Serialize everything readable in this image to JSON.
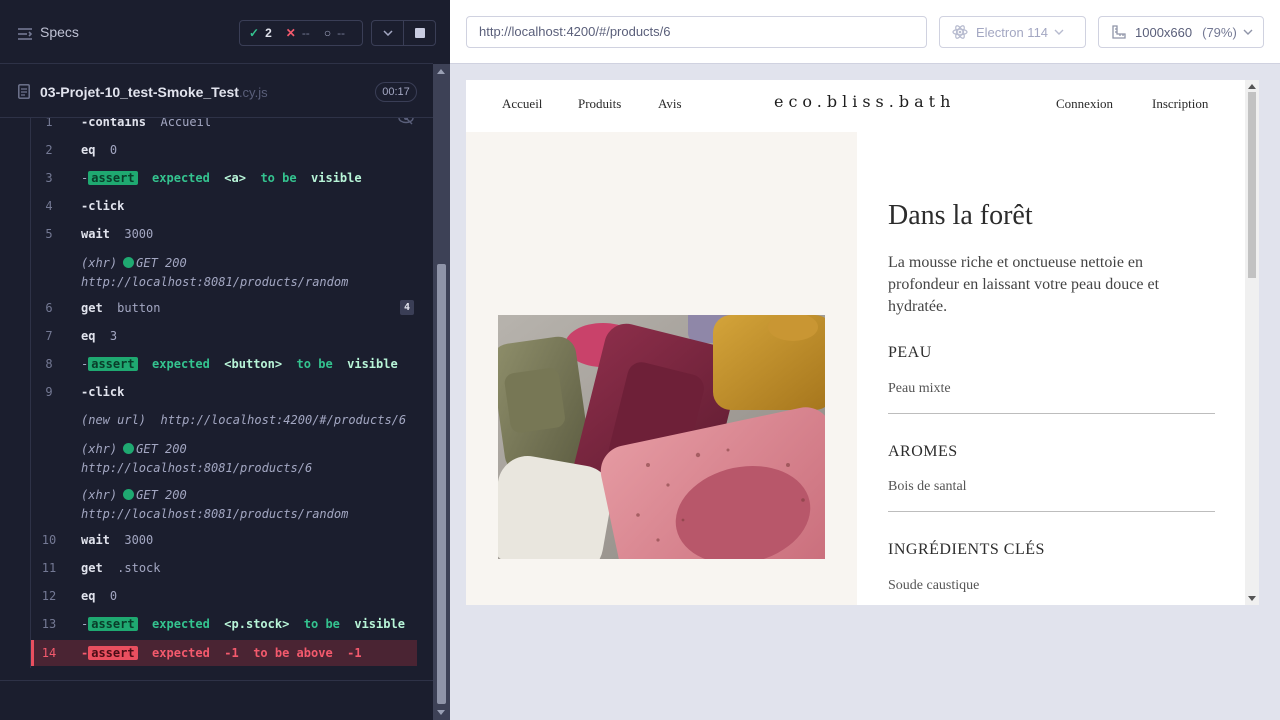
{
  "runner": {
    "specs_label": "Specs",
    "stats": {
      "passed": "2",
      "failed": "--",
      "pending": "--"
    },
    "file": {
      "name": "03-Projet-10_test-Smoke_Test",
      "ext": ".cy.js",
      "duration": "00:17"
    }
  },
  "commands": [
    {
      "num": "1",
      "parts": [
        "-contains",
        "Accueil"
      ]
    },
    {
      "num": "2",
      "parts": [
        "eq",
        "0"
      ]
    },
    {
      "num": "3",
      "parts": [
        "-",
        "assert",
        "expected",
        "<a>",
        "to be",
        "visible"
      ]
    },
    {
      "num": "4",
      "parts": [
        "-click"
      ]
    },
    {
      "num": "5",
      "parts": [
        "wait",
        "3000"
      ]
    },
    {
      "num": "",
      "parts": [
        "(xhr)",
        "GET 200",
        "http://localhost:8081/products/random"
      ]
    },
    {
      "num": "6",
      "parts": [
        "get",
        "button",
        "4"
      ]
    },
    {
      "num": "7",
      "parts": [
        "eq",
        "3"
      ]
    },
    {
      "num": "8",
      "parts": [
        "-",
        "assert",
        "expected",
        "<button>",
        "to be",
        "visible"
      ]
    },
    {
      "num": "9",
      "parts": [
        "-click"
      ]
    },
    {
      "num": "",
      "parts": [
        "(new url)",
        "http://localhost:4200/#/products/6"
      ]
    },
    {
      "num": "",
      "parts": [
        "(xhr)",
        "GET 200",
        "http://localhost:8081/products/6"
      ]
    },
    {
      "num": "",
      "parts": [
        "(xhr)",
        "GET 200",
        "http://localhost:8081/products/random"
      ]
    },
    {
      "num": "10",
      "parts": [
        "wait",
        "3000"
      ]
    },
    {
      "num": "11",
      "parts": [
        "get",
        ".stock"
      ]
    },
    {
      "num": "12",
      "parts": [
        "eq",
        "0"
      ]
    },
    {
      "num": "13",
      "parts": [
        "-",
        "assert",
        "expected",
        "<p.stock>",
        "to be",
        "visible"
      ]
    },
    {
      "num": "14",
      "parts": [
        "-",
        "assert",
        "expected",
        "-1",
        "to be above",
        "-1"
      ]
    }
  ],
  "browser": {
    "url": "http://localhost:4200/#/products/6",
    "browser_label": "Electron 114",
    "viewport": "1000x660",
    "zoom": "(79%)"
  },
  "site": {
    "nav": {
      "home": "Accueil",
      "products": "Produits",
      "reviews": "Avis",
      "login": "Connexion",
      "signup": "Inscription"
    },
    "logo": "eco.bliss.bath",
    "product": {
      "title": "Dans la forêt",
      "description": "La mousse riche et onctueuse nettoie en profondeur en laissant votre peau douce et hydratée.",
      "sections": [
        {
          "heading": "PEAU",
          "value": "Peau mixte"
        },
        {
          "heading": "AROMES",
          "value": "Bois de santal"
        },
        {
          "heading": "INGRÉDIENTS CLÉS",
          "value": "Soude caustique"
        }
      ]
    }
  }
}
